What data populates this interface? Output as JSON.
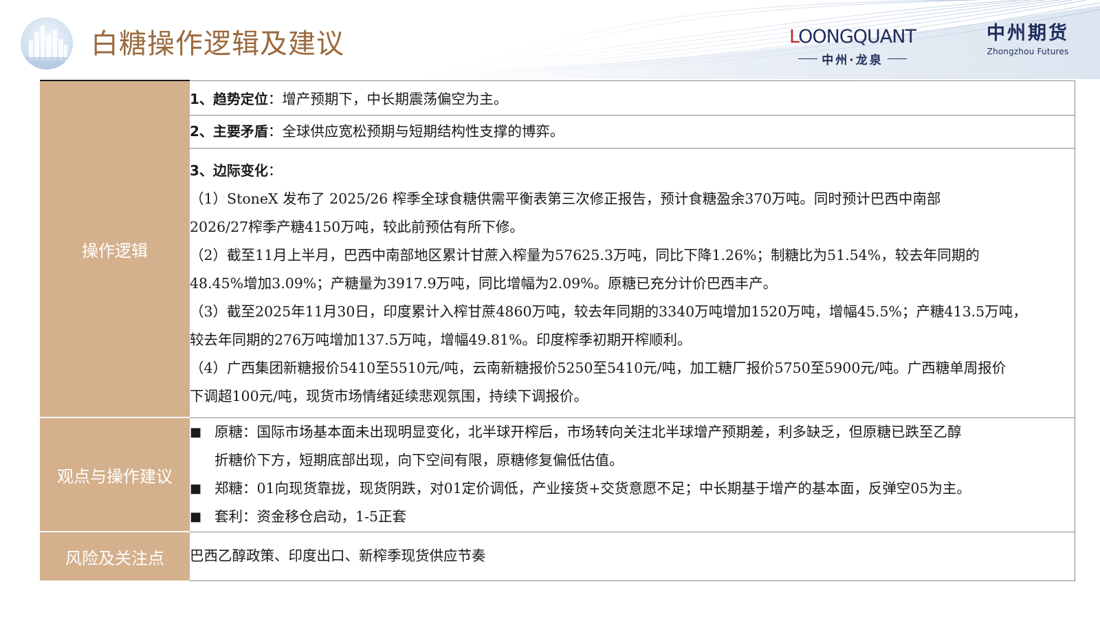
{
  "header": {
    "title": "白糖操作逻辑及建议",
    "logo_loongquant": {
      "word": "LOONGQUANT",
      "sub": "中州·龙泉"
    },
    "logo_zhongzhou": {
      "cn": "中州期货",
      "en": "Zhongzhou Futures"
    }
  },
  "colors": {
    "label_bg": "#d4b08c",
    "title": "#9b6a3d",
    "logo_navy": "#1f2d5c"
  },
  "logic": {
    "label": "操作逻辑",
    "item1": {
      "head": "1、趋势定位",
      "text": "：增产预期下，中长期震荡偏空为主。"
    },
    "item2": {
      "head": "2、主要矛盾",
      "text": "：全球供应宽松预期与短期结构性支撑的博弈。"
    },
    "item3": {
      "head": "3、边际变化",
      "text": "："
    },
    "lines": [
      "（1）StoneX 发布了 2025/26 榨季全球食糖供需平衡表第三次修正报告，预计食糖盈余370万吨。同时预计巴西中南部",
      "2026/27榨季产糖4150万吨，较此前预估有所下修。",
      "（2）截至11月上半月，巴西中南部地区累计甘蔗入榨量为57625.3万吨，同比下降1.26%；制糖比为51.54%，较去年同期的",
      "48.45%增加3.09%；产糖量为3917.9万吨，同比增幅为2.09%。原糖已充分计价巴西丰产。",
      "（3）截至2025年11月30日，印度累计入榨甘蔗4860万吨，较去年同期的3340万吨增加1520万吨，增幅45.5%；产糖413.5万吨，",
      "较去年同期的276万吨增加137.5万吨，增幅49.81%。印度榨季初期开榨顺利。",
      "（4）广西集团新糖报价5410至5510元/吨，云南新糖报价5250至5410元/吨，加工糖厂报价5750至5900元/吨。广西糖单周报价",
      "下调超100元/吨，现货市场情绪延续悲观氛围，持续下调报价。"
    ]
  },
  "advice": {
    "label": "观点与操作建议",
    "bullet": "■",
    "raw_line1": "原糖：国际市场基本面未出现明显变化，北半球开榨后，市场转向关注北半球增产预期差，利多缺乏，但原糖已跌至乙醇",
    "raw_line2": "折糖价下方，短期底部出现，向下空间有限，原糖修复偏低估值。",
    "zheng": "郑糖：01向现货靠拢，现货阴跌，对01定价调低，产业接货+交货意愿不足；中长期基于增产的基本面，反弹空05为主。",
    "arb": "套利：资金移仓启动，1-5正套"
  },
  "risk": {
    "label": "风险及关注点",
    "text": "巴西乙醇政策、印度出口、新榨季现货供应节奏"
  }
}
